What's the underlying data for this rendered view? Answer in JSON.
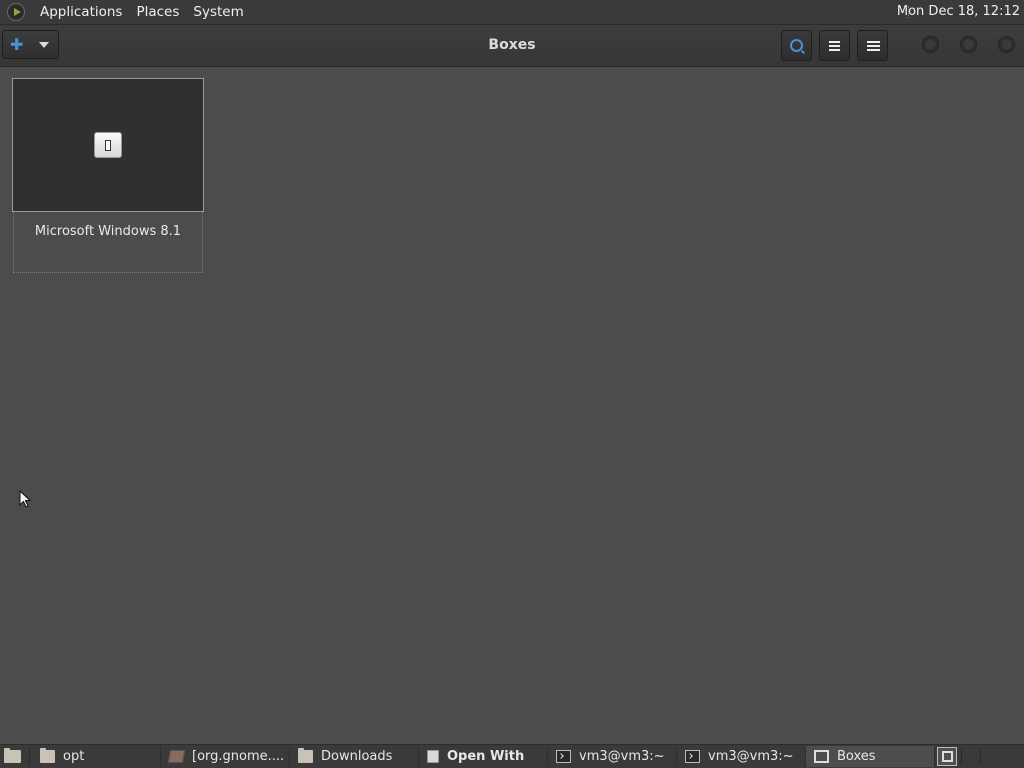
{
  "top_panel": {
    "menus": [
      "Applications",
      "Places",
      "System"
    ],
    "clock": "Mon Dec 18, 12:12"
  },
  "header": {
    "title": "Boxes",
    "new_button_icon": "plus-icon",
    "buttons": [
      "search-icon",
      "list-view-icon",
      "menu-icon"
    ],
    "accent": "#4a90d9"
  },
  "boxes": [
    {
      "name": "Microsoft Windows 8.1",
      "icon": "vm-icon"
    }
  ],
  "taskbar": {
    "tasks": [
      {
        "label": "opt",
        "icon": "folder-icon"
      },
      {
        "label": "[org.gnome....",
        "icon": "text-editor-icon"
      },
      {
        "label": "Downloads",
        "icon": "folder-icon"
      },
      {
        "label": "Open With",
        "icon": "document-icon"
      },
      {
        "label": "vm3@vm3:~",
        "icon": "terminal-icon"
      },
      {
        "label": "vm3@vm3:~",
        "icon": "terminal-icon"
      },
      {
        "label": "Boxes",
        "icon": "boxes-icon"
      }
    ],
    "tray_icon": "boxes-icon"
  }
}
